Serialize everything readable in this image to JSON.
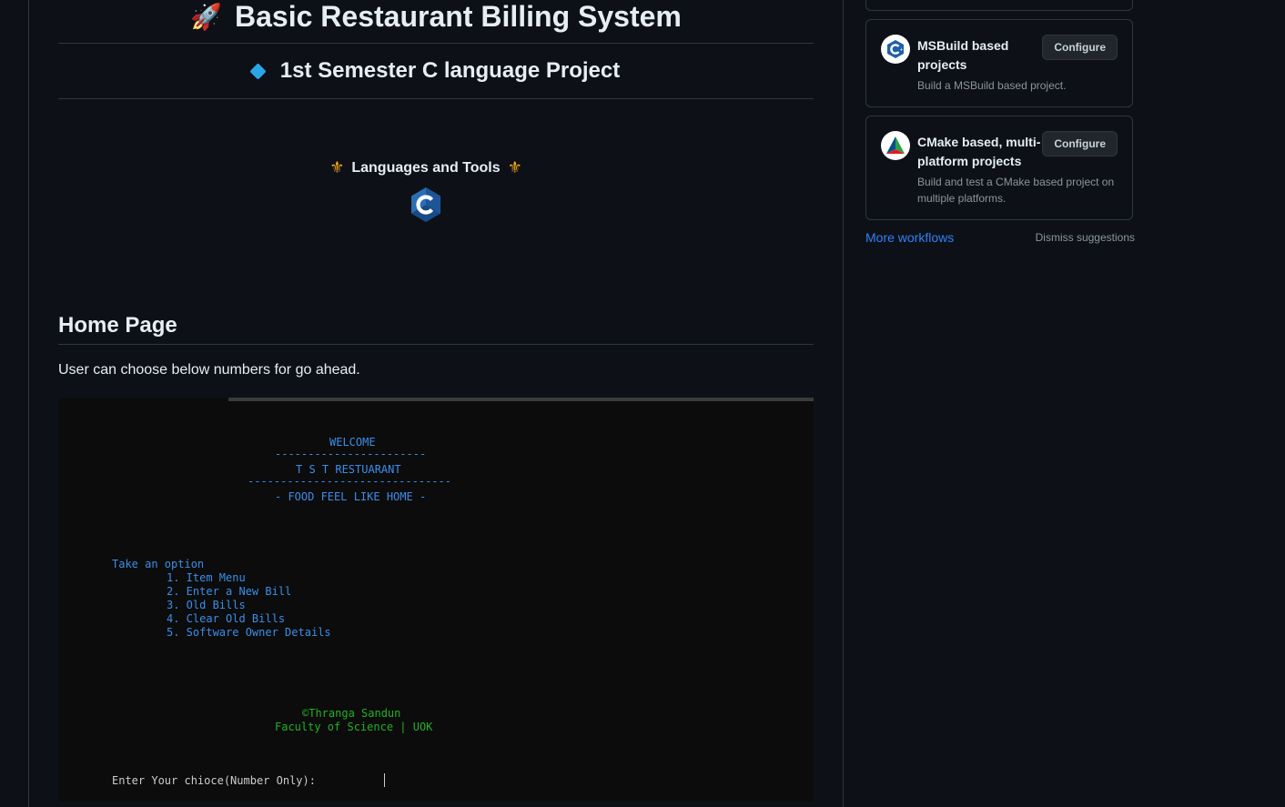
{
  "readme": {
    "title": "Basic Restaurant Billing System",
    "subtitle": "1st Semester C language Project",
    "tools_heading": "Languages and Tools",
    "home_heading": "Home Page",
    "home_paragraph": "User can choose below numbers for go ahead."
  },
  "console": {
    "welcome": "WELCOME",
    "rule_short": "-----------------------",
    "restaurant": "T S T RESTUARANT",
    "rule_long": "-------------------------------",
    "tagline": "- FOOD FEEL LIKE HOME -",
    "take_option": "Take an option",
    "options": [
      "1. Item Menu",
      "2. Enter a New Bill",
      "3. Old Bills",
      "4. Clear Old Bills",
      "5. Software Owner Details"
    ],
    "credit_name": "©Thranga Sandun",
    "credit_faculty": "Faculty of Science | UOK",
    "prompt": "Enter Your chioce(Number Only):"
  },
  "sidebar": {
    "workflows": [
      {
        "title": "MSBuild based projects",
        "description": "Build a MSBuild based project.",
        "button": "Configure",
        "icon": "msbuild-icon"
      },
      {
        "title": "CMake based, multi-platform projects",
        "description": "Build and test a CMake based project on multiple platforms.",
        "button": "Configure",
        "icon": "cmake-icon"
      }
    ],
    "more_workflows": "More workflows",
    "dismiss": "Dismiss suggestions"
  },
  "colors": {
    "background": "#0d1117",
    "console_blue": "#3b8eea",
    "console_green": "#23b123",
    "link": "#2f81f7"
  }
}
